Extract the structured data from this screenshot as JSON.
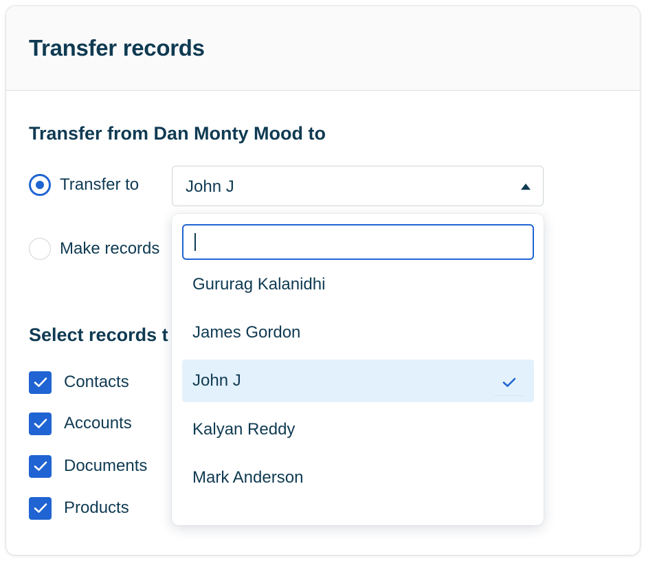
{
  "dialog": {
    "title": "Transfer records"
  },
  "transfer": {
    "heading": "Transfer from Dan Monty Mood to",
    "options": [
      {
        "label": "Transfer to",
        "checked": true
      },
      {
        "label": "Make records",
        "checked": false
      }
    ],
    "select": {
      "value": "John J"
    }
  },
  "records": {
    "heading": "Select records t",
    "items": [
      {
        "label": "Contacts",
        "checked": true
      },
      {
        "label": "Accounts",
        "checked": true
      },
      {
        "label": "Documents",
        "checked": true
      },
      {
        "label": "Products",
        "checked": true
      }
    ]
  },
  "dropdown": {
    "search": {
      "value": "",
      "placeholder": ""
    },
    "options": [
      {
        "label": "Gururag Kalanidhi",
        "selected": false
      },
      {
        "label": "James Gordon",
        "selected": false
      },
      {
        "label": "John J",
        "selected": true
      },
      {
        "label": "Kalyan Reddy",
        "selected": false
      },
      {
        "label": "Mark Anderson",
        "selected": false
      }
    ]
  },
  "colors": {
    "accent": "#1f64d2",
    "text": "#0f3a52",
    "selected_bg": "#e3f1fc"
  },
  "icons": {
    "caret": "caret-up-icon",
    "check": "check-icon"
  }
}
